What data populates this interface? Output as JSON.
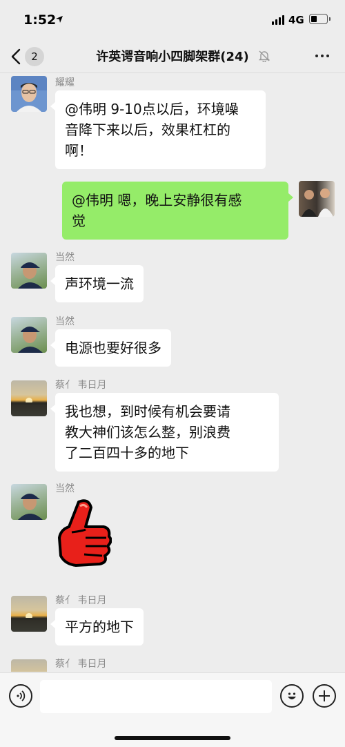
{
  "status_bar": {
    "time": "1:52",
    "network": "4G",
    "battery_level": 0.3
  },
  "nav": {
    "back_badge": "2",
    "title": "许英谔音响小四脚架群(24)",
    "icons": [
      "chevron-left-icon",
      "bell-muted-icon",
      "more-icon"
    ]
  },
  "messages": [
    {
      "sender": "耀耀",
      "direction": "in",
      "text": "@伟明  9-10点以后，环境噪音降下来以后，效果杠杠的啊！",
      "lines": [
        "@伟明  9-10点以后，环境噪",
        "音降下来以后，效果杠杠的",
        "啊！"
      ]
    },
    {
      "sender": "",
      "direction": "out",
      "text": "@伟明 嗯，晚上安静很有感觉",
      "lines": [
        "@伟明 嗯，晚上安静很有感",
        "觉"
      ]
    },
    {
      "sender": "当然",
      "direction": "in",
      "text": "声环境一流"
    },
    {
      "sender": "当然",
      "direction": "in",
      "text": "电源也要好很多"
    },
    {
      "sender": "蔡亻 韦日月",
      "direction": "in",
      "text": "我也想，到时候有机会要请教大神们该怎么整，别浪费了二百四十多的地下",
      "lines": [
        "我也想，到时候有机会要请",
        "教大神们该怎么整，别浪费",
        "了二百四十多的地下"
      ]
    },
    {
      "sender": "当然",
      "direction": "in",
      "sticker": "thumbs-up-sticker"
    },
    {
      "sender": "蔡亻 韦日月",
      "direction": "in",
      "text": "平方的地下"
    },
    {
      "sender": "蔡亻 韦日月",
      "direction": "in",
      "text": ""
    }
  ],
  "input_bar": {
    "icons": [
      "voice-icon",
      "emoji-icon",
      "plus-icon"
    ]
  },
  "colors": {
    "background": "#ededed",
    "bubble_in": "#ffffff",
    "bubble_out": "#95ec69"
  }
}
